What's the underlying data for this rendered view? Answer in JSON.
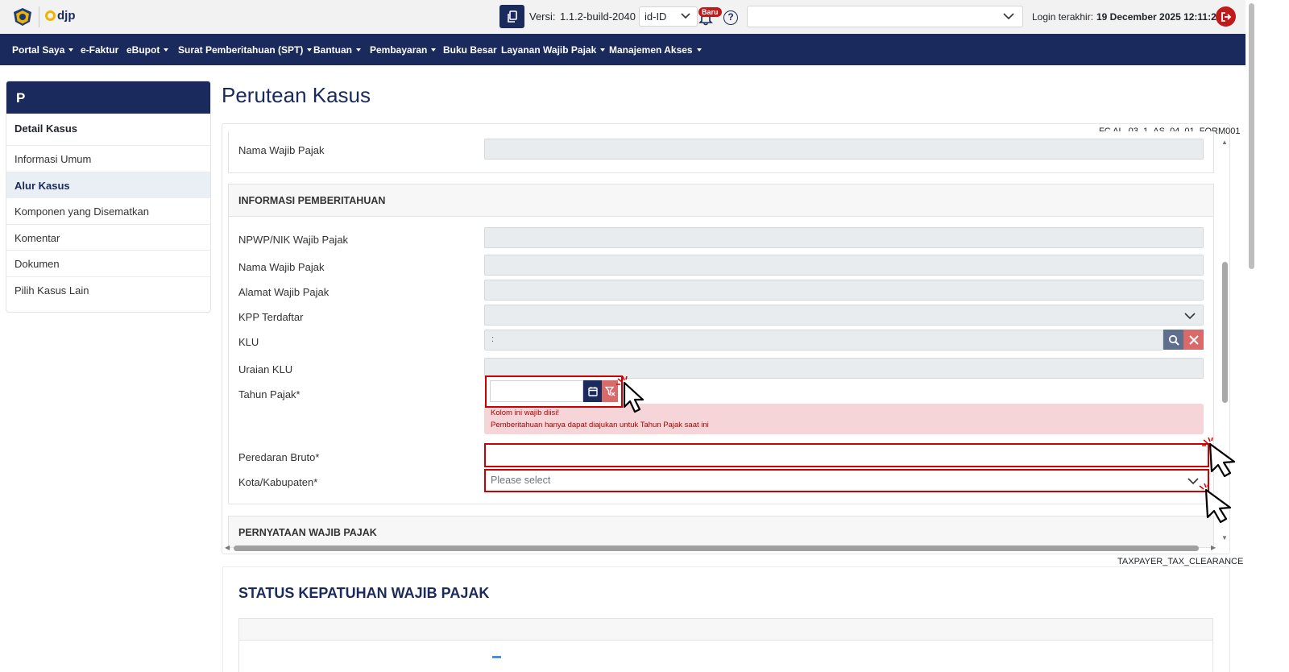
{
  "topbar": {
    "logo_text": "djp",
    "version_label": "Versi:",
    "version_value": "1.1.2-build-2040",
    "language": "id-ID",
    "badge": "Baru",
    "help": "?",
    "profile_value": "",
    "login_label": "Login terakhir:",
    "login_value": "19 December 2025 12:11:24"
  },
  "nav": {
    "items": [
      {
        "label": "Portal Saya",
        "dropdown": true
      },
      {
        "label": "e-Faktur",
        "dropdown": false
      },
      {
        "label": "eBupot",
        "dropdown": true
      },
      {
        "label": "Surat Pemberitahuan (SPT)",
        "dropdown": true
      },
      {
        "label": "Bantuan",
        "dropdown": true
      },
      {
        "label": "Pembayaran",
        "dropdown": true
      },
      {
        "label": "Buku Besar",
        "dropdown": false
      },
      {
        "label": "Layanan Wajib Pajak",
        "dropdown": true
      },
      {
        "label": "Manajemen Akses",
        "dropdown": true
      }
    ]
  },
  "sidebar": {
    "avatar_letter": "P",
    "title": "Detail Kasus",
    "items": [
      {
        "label": "Informasi Umum",
        "active": false
      },
      {
        "label": "Alur Kasus",
        "active": true
      },
      {
        "label": "Komponen yang Disematkan",
        "active": false
      },
      {
        "label": "Komentar",
        "active": false
      },
      {
        "label": "Dokumen",
        "active": false
      },
      {
        "label": "Pilih Kasus Lain",
        "active": false
      }
    ]
  },
  "main": {
    "page_title": "Perutean Kasus",
    "form_code": "FC AL_03_1_AS_04_01_FORM001",
    "top_field_label": "Nama Wajib Pajak",
    "section_notification": "INFORMASI PEMBERITAHUAN",
    "fields": {
      "npwp": {
        "label": "NPWP/NIK Wajib Pajak",
        "value": ""
      },
      "nama": {
        "label": "Nama Wajib Pajak",
        "value": ""
      },
      "alamat": {
        "label": "Alamat Wajib Pajak",
        "value": ""
      },
      "kpp": {
        "label": "KPP Terdaftar",
        "value": ""
      },
      "klu": {
        "label": "KLU",
        "value": ":"
      },
      "uraian": {
        "label": "Uraian KLU",
        "value": ""
      },
      "tahun": {
        "label": "Tahun Pajak*",
        "value": ""
      },
      "peredaran": {
        "label": "Peredaran Bruto*",
        "value": ""
      },
      "kota": {
        "label": "Kota/Kabupaten*",
        "placeholder": "Please select"
      }
    },
    "errors": [
      "Kolom ini wajib diisi!",
      "Pemberitahuan hanya dapat diajukan untuk Tahun Pajak saat ini"
    ],
    "section_statement": "PERNYATAAN WAJIB PAJAK",
    "tax_clearance_code": "TAXPAYER_TAX_CLEARANCE",
    "status_title": "STATUS KEPATUHAN WAJIB PAJAK"
  },
  "colors": {
    "navy": "#1a2a5c",
    "error_red": "#cc0000",
    "error_bg": "#f5d5d8",
    "readonly_bg": "#e9ecef"
  },
  "icons": [
    "emblem-icon",
    "copy-icon",
    "chevron-down-icon",
    "bell-icon",
    "help-icon",
    "logout-icon",
    "search-icon",
    "close-icon",
    "calendar-icon",
    "filter-clear-icon",
    "cursor-icon"
  ]
}
